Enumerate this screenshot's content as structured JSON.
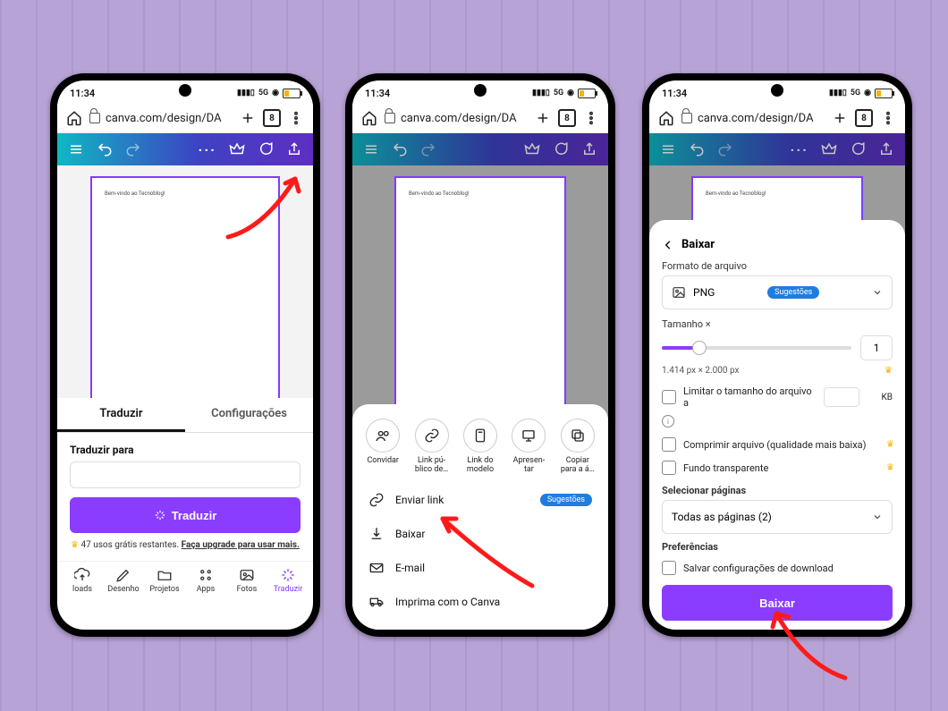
{
  "status": {
    "time": "11:34",
    "net": "5G",
    "wifi_icon": "wifi"
  },
  "browser": {
    "url": "canva.com/design/DA",
    "tab_count": "8"
  },
  "canvas_text": "Bem-vindo ao Tecnoblog!",
  "phone1": {
    "tabs": {
      "translate": "Traduzir",
      "settings": "Configurações"
    },
    "translate_for_label": "Traduzir para",
    "primary_btn": "Traduzir",
    "uses_prefix": "47 usos grátis restantes.",
    "uses_link": "Faça upgrade para usar mais.",
    "nav": {
      "uploads": "loads",
      "draw": "Desenho",
      "projects": "Projetos",
      "apps": "Apps",
      "photos": "Fotos",
      "translate": "Traduzir"
    }
  },
  "phone2": {
    "share": {
      "invite": "Convidar",
      "public_link": "Link pú-blico de…",
      "template_link": "Link do modelo",
      "present": "Apresen-tar",
      "copy": "Copiar para a á…"
    },
    "rows": {
      "send_link": "Enviar link",
      "suggestions": "Sugestões",
      "download": "Baixar",
      "email": "E-mail",
      "print": "Imprima com o Canva"
    }
  },
  "phone3": {
    "title": "Baixar",
    "file_format_label": "Formato de arquivo",
    "file_format_value": "PNG",
    "file_format_badge": "Sugestões",
    "size_label": "Tamanho ×",
    "size_value": "1",
    "size_dims": "1.414 px × 2.000 px",
    "limit_label": "Limitar o tamanho do arquivo a",
    "kb_unit": "KB",
    "compress_label": "Comprimir arquivo (qualidade mais baixa)",
    "transparent_label": "Fundo transparente",
    "select_pages_label": "Selecionar páginas",
    "select_pages_value": "Todas as páginas (2)",
    "prefs_label": "Preferências",
    "prefs_save": "Salvar configurações de download",
    "primary_btn": "Baixar"
  }
}
